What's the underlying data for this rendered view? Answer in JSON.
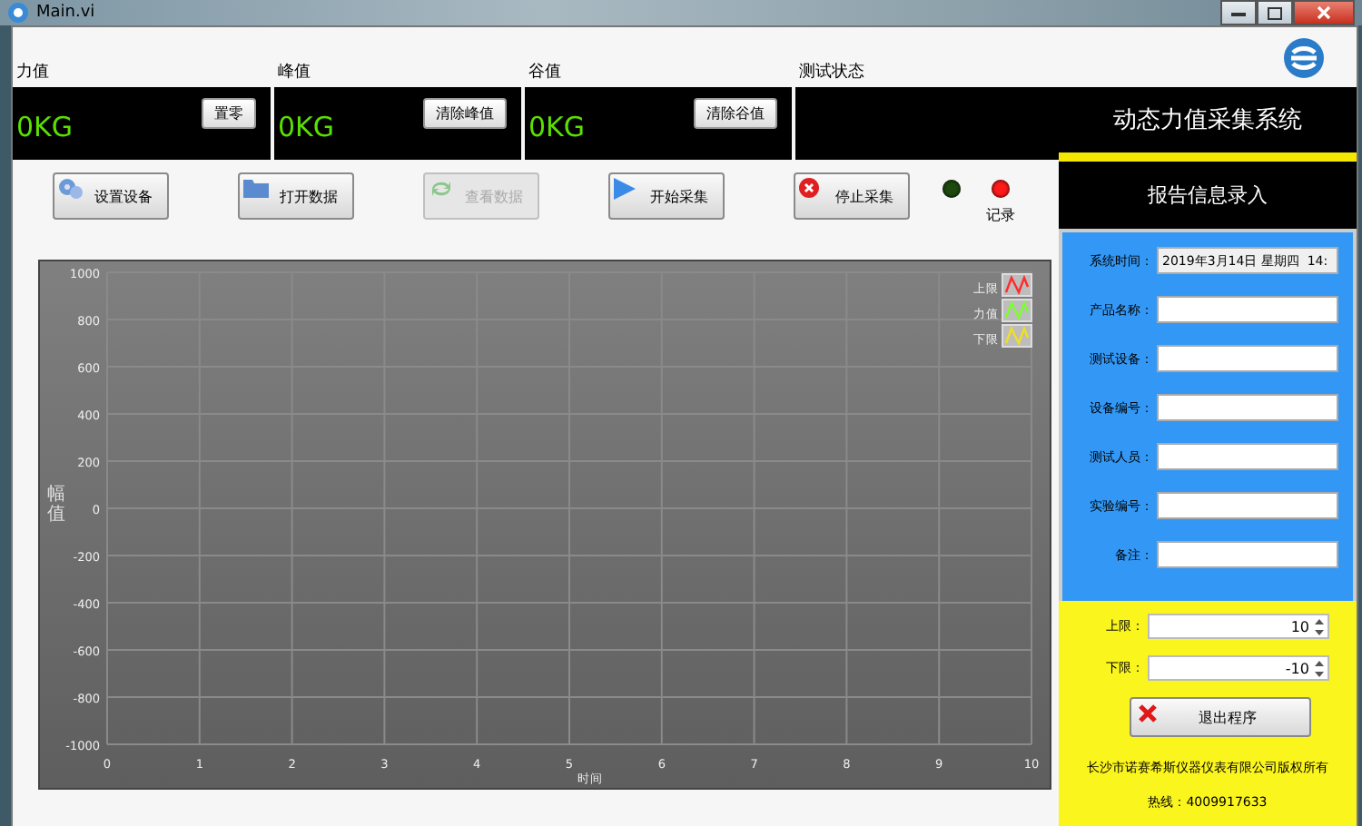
{
  "window": {
    "title": "Main.vi"
  },
  "meters": [
    {
      "label": "力值",
      "value": "0KG",
      "button": "置零"
    },
    {
      "label": "峰值",
      "value": "0KG",
      "button": "清除峰值"
    },
    {
      "label": "谷值",
      "value": "0KG",
      "button": "清除谷值"
    },
    {
      "label": "测试状态"
    }
  ],
  "toolbar": [
    {
      "label": "设置设备",
      "kind": "settings",
      "disabled": false
    },
    {
      "label": "打开数据",
      "kind": "folder",
      "disabled": false
    },
    {
      "label": "查看数据",
      "kind": "refresh",
      "disabled": true
    },
    {
      "label": "开始采集",
      "kind": "play",
      "disabled": false
    },
    {
      "label": "停止采集",
      "kind": "stop",
      "disabled": false
    }
  ],
  "leds": [
    {
      "color": "#1e4a10"
    },
    {
      "color": "#ff1a1a",
      "label": "记录"
    }
  ],
  "chart": {
    "chart_data": {
      "type": "line",
      "xlabel": "时间",
      "ylabel": "幅值",
      "categories": [
        "0",
        "1",
        "2",
        "3",
        "4",
        "5",
        "6",
        "7",
        "8",
        "9",
        "10"
      ],
      "grid": true,
      "ylim": [
        -1000,
        1000
      ],
      "yticks": [
        -1000,
        -800,
        -600,
        -400,
        -200,
        0,
        200,
        400,
        600,
        800,
        1000
      ],
      "series": [
        {
          "name": "上限",
          "color": "#ff2a2a",
          "values": [
            null,
            null,
            null,
            null,
            null,
            null,
            null,
            null,
            null,
            null,
            null
          ]
        },
        {
          "name": "力值",
          "color": "#7cff2a",
          "values": [
            null,
            null,
            null,
            null,
            null,
            null,
            null,
            null,
            null,
            null,
            null
          ]
        },
        {
          "name": "下限",
          "color": "#f0e020",
          "values": [
            null,
            null,
            null,
            null,
            null,
            null,
            null,
            null,
            null,
            null,
            null
          ]
        }
      ]
    }
  },
  "side": {
    "title": "动态力值采集系统",
    "subtitle": "报告信息录入",
    "fields": [
      {
        "label": "系统时间：",
        "value": "2019年3月14日 星期四  14:",
        "readonly": true
      },
      {
        "label": "产品名称：",
        "readonly": false
      },
      {
        "label": "测试设备：",
        "readonly": false
      },
      {
        "label": "设备编号：",
        "readonly": false
      },
      {
        "label": "测试人员：",
        "readonly": false
      },
      {
        "label": "实验编号：",
        "readonly": false
      },
      {
        "label": "备注：",
        "readonly": false
      }
    ],
    "limits": [
      {
        "label": "上限：",
        "value": "10"
      },
      {
        "label": "下限：",
        "value": "-10"
      }
    ],
    "exit_button": "退出程序",
    "footer": [
      "长沙市诺赛希斯仪器仪表有限公司版权所有",
      "热线：4009917633"
    ]
  }
}
